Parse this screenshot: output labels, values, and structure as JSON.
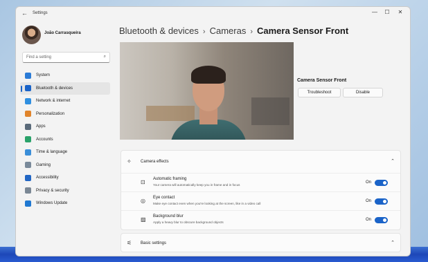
{
  "window": {
    "back_glyph": "←",
    "app_title": "Settings",
    "controls": {
      "minimize": "—",
      "maximize": "☐",
      "close": "✕"
    }
  },
  "user": {
    "name": "João Carrasqueira"
  },
  "search": {
    "placeholder": "Find a setting",
    "icon": "search-icon",
    "glyph": "⌕"
  },
  "sidebar": {
    "items": [
      {
        "label": "System",
        "icon": "system-icon",
        "color": "#2b7bd6",
        "active": false
      },
      {
        "label": "Bluetooth & devices",
        "icon": "bluetooth-icon",
        "color": "#1a63c8",
        "active": true
      },
      {
        "label": "Network & internet",
        "icon": "network-icon",
        "color": "#2f8fe0",
        "active": false
      },
      {
        "label": "Personalization",
        "icon": "brush-icon",
        "color": "#e0842b",
        "active": false
      },
      {
        "label": "Apps",
        "icon": "apps-icon",
        "color": "#5a6a7a",
        "active": false
      },
      {
        "label": "Accounts",
        "icon": "accounts-icon",
        "color": "#2aa26a",
        "active": false
      },
      {
        "label": "Time & language",
        "icon": "globe-icon",
        "color": "#3a8ed8",
        "active": false
      },
      {
        "label": "Gaming",
        "icon": "gamepad-icon",
        "color": "#7a8a9a",
        "active": false
      },
      {
        "label": "Accessibility",
        "icon": "accessibility-icon",
        "color": "#2266c4",
        "active": false
      },
      {
        "label": "Privacy & security",
        "icon": "shield-icon",
        "color": "#7a8794",
        "active": false
      },
      {
        "label": "Windows Update",
        "icon": "update-icon",
        "color": "#1f78d1",
        "active": false
      }
    ]
  },
  "breadcrumb": {
    "items": [
      "Bluetooth & devices",
      "Cameras"
    ],
    "current": "Camera Sensor Front",
    "separator": "›"
  },
  "camera": {
    "name": "Camera Sensor Front",
    "troubleshoot_label": "Troubleshoot",
    "disable_label": "Disable"
  },
  "effects": {
    "title": "Camera effects",
    "icon": "sparkle-icon",
    "icon_glyph": "✧",
    "chevron_glyph": "⌃",
    "rows": [
      {
        "title": "Automatic framing",
        "description": "Your camera will automatically keep you in frame and in focus",
        "state": "On",
        "icon": "framing-icon",
        "glyph": "⊡"
      },
      {
        "title": "Eye contact",
        "description": "Make eye contact even when you're looking at the screen, like in a video call",
        "state": "On",
        "icon": "eye-contact-icon",
        "glyph": "◎"
      },
      {
        "title": "Background blur",
        "description": "Apply a heavy blur to obscure background objects",
        "state": "On",
        "icon": "background-blur-icon",
        "glyph": "▨"
      }
    ]
  },
  "basic": {
    "title": "Basic settings",
    "icon": "sliders-icon",
    "icon_glyph": "⚟",
    "chevron_glyph": "⌃"
  },
  "colors": {
    "accent": "#1a63c8"
  }
}
